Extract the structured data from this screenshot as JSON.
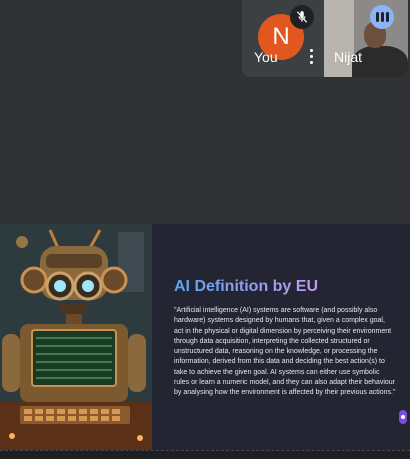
{
  "participants": {
    "you": {
      "initial": "N",
      "name": "You",
      "avatar_color": "#e0571f",
      "muted": true
    },
    "nijat": {
      "name": "Nijat",
      "speaking": true
    }
  },
  "slide": {
    "title": "AI Definition by EU",
    "body": "\"Artificial intelligence (AI) systems are software (and possibly also hardware) systems designed by humans that, given a complex goal, act in the physical or digital dimension by perceiving their environment through data acquisition, interpreting the collected structured or unstructured data, reasoning on the knowledge, or processing the information, derived from this data and deciding the best action(s) to take to achieve the given goal. AI systems can either use symbolic rules or learn a numeric model, and they can also adapt their behaviour by analysing how the environment is affected by their previous actions.\"",
    "title_gradient": [
      "#5aa4f3",
      "#c29af2"
    ]
  },
  "icons": {
    "mic": "mic-off-icon",
    "more": "more-vert-icon",
    "speaking": "audio-level-icon"
  }
}
